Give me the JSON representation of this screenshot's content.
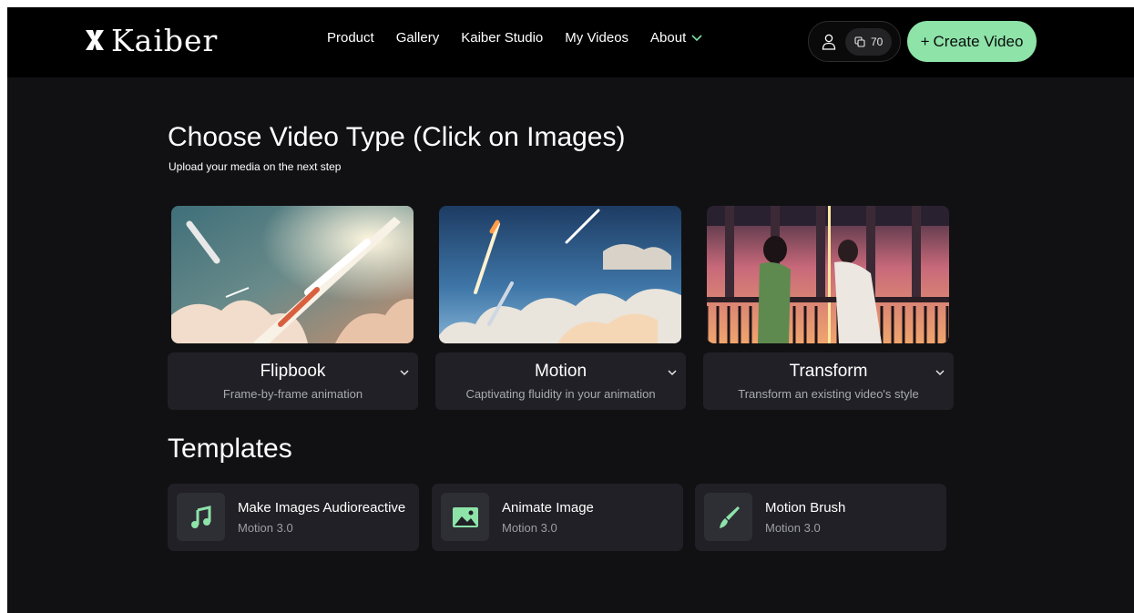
{
  "brand": {
    "name": "Kaiber"
  },
  "nav": {
    "items": [
      {
        "label": "Product"
      },
      {
        "label": "Gallery"
      },
      {
        "label": "Kaiber Studio"
      },
      {
        "label": "My Videos"
      },
      {
        "label": "About"
      }
    ],
    "credits": "70",
    "create_button": {
      "icon": "+",
      "label": "Create Video"
    }
  },
  "page": {
    "title": "Choose Video Type (Click on Images)",
    "subtitle": "Upload your media on the next step"
  },
  "video_types": [
    {
      "title": "Flipbook",
      "description": "Frame-by-frame animation"
    },
    {
      "title": "Motion",
      "description": "Captivating fluidity in your animation"
    },
    {
      "title": "Transform",
      "description": "Transform an existing video's style"
    }
  ],
  "templates": {
    "heading": "Templates",
    "items": [
      {
        "title": "Make Images Audioreactive",
        "subtitle": "Motion 3.0",
        "icon": "music-note-icon"
      },
      {
        "title": "Animate Image",
        "subtitle": "Motion 3.0",
        "icon": "image-icon"
      },
      {
        "title": "Motion Brush",
        "subtitle": "Motion 3.0",
        "icon": "brush-icon"
      }
    ]
  },
  "colors": {
    "accent": "#8de3a8",
    "background": "#111113",
    "nav": "#000000",
    "card": "#202026"
  }
}
